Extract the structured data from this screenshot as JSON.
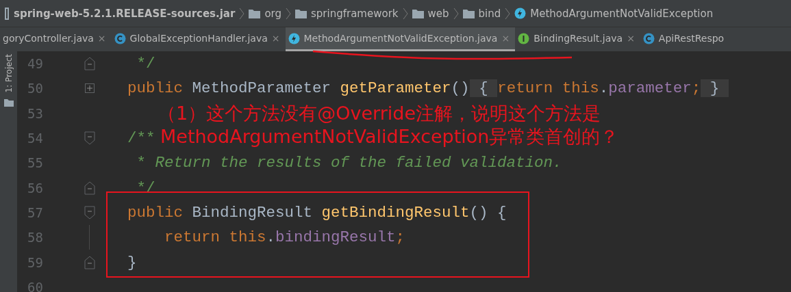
{
  "breadcrumbs": [
    {
      "label": "spring-web-5.2.1.RELEASE-sources.jar",
      "kind": "jar"
    },
    {
      "label": "org",
      "kind": "folder"
    },
    {
      "label": "springframework",
      "kind": "folder"
    },
    {
      "label": "web",
      "kind": "folder"
    },
    {
      "label": "bind",
      "kind": "folder"
    },
    {
      "label": "MethodArgumentNotValidException",
      "kind": "exception"
    }
  ],
  "tabs": [
    {
      "label": "goryController.java",
      "kind": "plain",
      "selected": false,
      "close": "×"
    },
    {
      "label": "GlobalExceptionHandler.java",
      "kind": "class",
      "selected": false,
      "close": "×"
    },
    {
      "label": "MethodArgumentNotValidException.java",
      "kind": "exception",
      "selected": true,
      "close": "×"
    },
    {
      "label": "BindingResult.java",
      "kind": "interface",
      "selected": false,
      "close": "×"
    },
    {
      "label": "ApiRestRespo",
      "kind": "class",
      "selected": false
    }
  ],
  "sidebar": {
    "label": "1: Project"
  },
  "lines": [
    {
      "number": "49",
      "kind": "fold-end",
      "tokens": [
        {
          "kind": "doc",
          "text": "     */"
        }
      ]
    },
    {
      "number": "50",
      "kind": "folded",
      "tokens": [
        {
          "kind": "keyword",
          "text": "    public "
        },
        {
          "kind": "plain",
          "text": "MethodParameter "
        },
        {
          "kind": "method",
          "text": "getParameter"
        },
        {
          "kind": "plain",
          "text": "()"
        },
        {
          "kind": "folded",
          "text": " { "
        },
        {
          "kind": "keyword",
          "text": "return this"
        },
        {
          "kind": "plain",
          "text": "."
        },
        {
          "kind": "field",
          "text": "parameter"
        },
        {
          "kind": "keyword",
          "text": ";"
        },
        {
          "kind": "folded",
          "text": " } "
        }
      ]
    },
    {
      "number": "53",
      "kind": "plain"
    },
    {
      "number": "54",
      "kind": "fold-start",
      "tokens": [
        {
          "kind": "doc",
          "text": "    /**"
        }
      ]
    },
    {
      "number": "55",
      "kind": "plain",
      "tokens": [
        {
          "kind": "doc",
          "text": "     * "
        },
        {
          "kind": "docitalic",
          "text": "Return the results of the failed validation."
        }
      ]
    },
    {
      "number": "56",
      "kind": "fold-end",
      "tokens": [
        {
          "kind": "doc",
          "text": "     */"
        }
      ]
    },
    {
      "number": "57",
      "kind": "fold-start",
      "tokens": [
        {
          "kind": "keyword",
          "text": "    public "
        },
        {
          "kind": "plain",
          "text": "BindingResult "
        },
        {
          "kind": "method",
          "text": "getBindingResult"
        },
        {
          "kind": "plain",
          "text": "() {"
        }
      ]
    },
    {
      "number": "58",
      "kind": "guide",
      "tokens": [
        {
          "kind": "keyword",
          "text": "        return this"
        },
        {
          "kind": "plain",
          "text": "."
        },
        {
          "kind": "field",
          "text": "bindingResult"
        },
        {
          "kind": "keyword",
          "text": ";"
        }
      ]
    },
    {
      "number": "59",
      "kind": "fold-end",
      "tokens": [
        {
          "kind": "plain",
          "text": "    }"
        }
      ]
    },
    {
      "number": "60",
      "kind": "plain"
    }
  ],
  "annotation": {
    "lines": [
      "（1）这个方法没有@Override注解，说明这个方法是",
      "MethodArgumentNotValidException异常类首创的？"
    ]
  }
}
